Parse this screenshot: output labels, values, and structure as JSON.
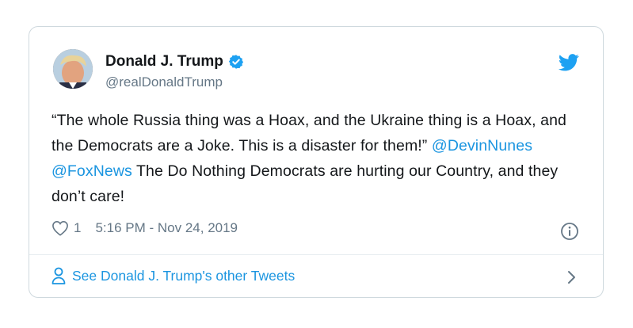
{
  "tweet": {
    "author_name": "Donald J. Trump",
    "handle": "@realDonaldTrump",
    "text_part1": "“The whole Russia thing was a Hoax, and the Ukraine thing is a Hoax, and the Democrats are a Joke. This is a disaster for them!” ",
    "mention1": "@DevinNunes",
    "space": " ",
    "mention2": "@FoxNews",
    "text_part2": " The Do Nothing Democrats are hurting our Country, and they don’t care!",
    "like_count": "1",
    "timestamp": "5:16 PM - Nov 24, 2019",
    "footer_link": "See Donald J. Trump's other Tweets"
  },
  "icons": {
    "verified": "verified-badge-icon",
    "bird": "twitter-bird-icon",
    "heart": "heart-icon",
    "info": "info-icon",
    "person": "person-icon",
    "chevron": "chevron-right-icon"
  },
  "colors": {
    "link": "#1b95e0",
    "muted": "#657786",
    "border": "#cfd9de"
  }
}
